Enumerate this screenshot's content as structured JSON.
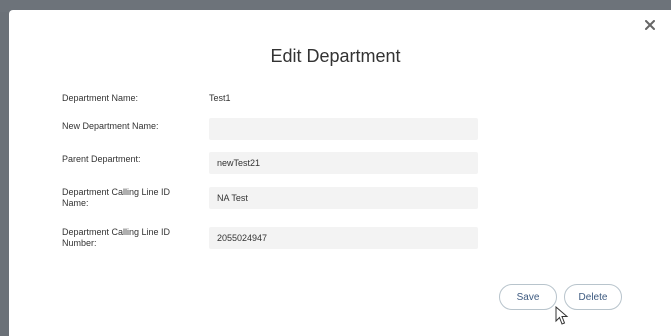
{
  "dialog": {
    "title": "Edit Department",
    "close_label": "×"
  },
  "form": {
    "department_name": {
      "label": "Department Name:",
      "value": "Test1"
    },
    "new_department_name": {
      "label": "New Department Name:",
      "value": ""
    },
    "parent_department": {
      "label": "Parent Department:",
      "value": "newTest21"
    },
    "calling_line_id_name": {
      "label": "Department Calling Line ID Name:",
      "value": "NA Test"
    },
    "calling_line_id_number": {
      "label": "Department Calling Line ID Number:",
      "value": "2055024947"
    }
  },
  "actions": {
    "save_label": "Save",
    "delete_label": "Delete"
  },
  "icons": {
    "close": "close-icon",
    "cursor": "pointer-cursor-icon"
  },
  "colors": {
    "backdrop": "#6b7178",
    "button_text": "#3d5a80",
    "field_bg": "#f3f3f3"
  }
}
